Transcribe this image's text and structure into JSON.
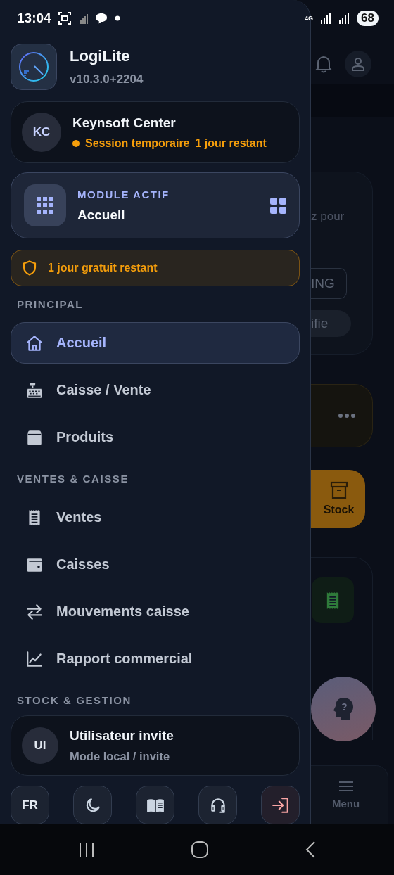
{
  "status_bar": {
    "time": "13:04",
    "network": "4G",
    "battery": "68"
  },
  "drawer": {
    "app": {
      "name": "LogiLite",
      "version": "v10.3.0+2204"
    },
    "account": {
      "initials": "KC",
      "name": "Keynsoft Center",
      "session": "Session temporaire",
      "remaining": "1 jour restant"
    },
    "module": {
      "label": "MODULE ACTIF",
      "name": "Accueil"
    },
    "trial_banner": "1 jour gratuit restant",
    "sections": [
      {
        "title": "PRINCIPAL",
        "items": [
          {
            "label": "Accueil",
            "kind": "home",
            "selected": true
          },
          {
            "label": "Caisse / Vente",
            "kind": "register",
            "selected": false
          },
          {
            "label": "Produits",
            "kind": "box",
            "selected": false
          }
        ]
      },
      {
        "title": "VENTES & CAISSE",
        "items": [
          {
            "label": "Ventes",
            "kind": "receipt",
            "selected": false
          },
          {
            "label": "Caisses",
            "kind": "wallet",
            "selected": false
          },
          {
            "label": "Mouvements caisse",
            "kind": "swap",
            "selected": false
          },
          {
            "label": "Rapport commercial",
            "kind": "chart",
            "selected": false
          }
        ]
      },
      {
        "title": "STOCK & GESTION"
      }
    ],
    "user": {
      "initials": "UI",
      "name": "Utilisateur invite",
      "mode": "Mode local / invite"
    },
    "footer_buttons": [
      {
        "kind": "language",
        "label": "FR"
      },
      {
        "kind": "moon"
      },
      {
        "kind": "book"
      },
      {
        "kind": "headset"
      },
      {
        "kind": "logout"
      }
    ]
  },
  "background_app": {
    "card_text": "z pour",
    "chip": "ING",
    "pill": "ifie",
    "stock_button": "Stock",
    "help_mark": "?",
    "nav_label": "Menu"
  }
}
